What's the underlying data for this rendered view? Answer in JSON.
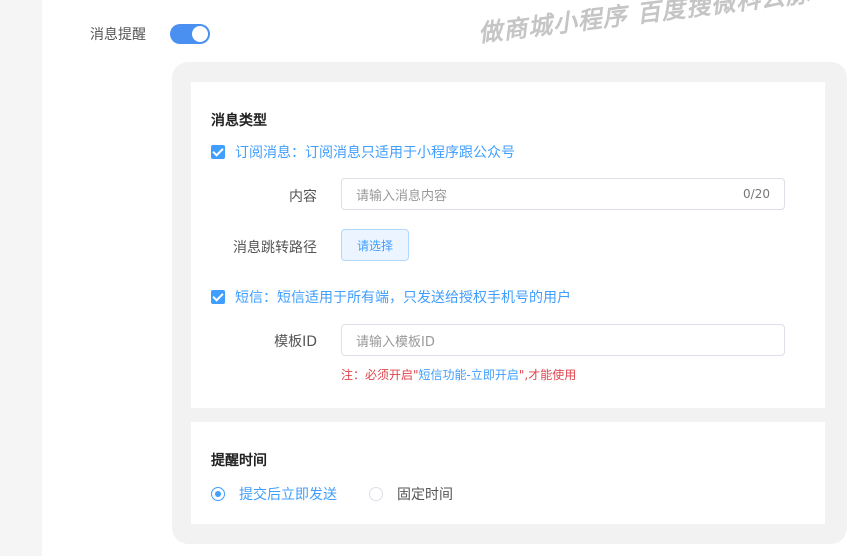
{
  "notify": {
    "label": "消息提醒",
    "enabled": true
  },
  "watermark": "做商城小程序 百度搜微科云脉",
  "message_type": {
    "title": "消息类型",
    "subscribe": {
      "checked": true,
      "label": "订阅消息：订阅消息只适用于小程序跟公众号"
    },
    "content": {
      "label": "内容",
      "placeholder": "请输入消息内容",
      "counter": "0/20"
    },
    "path": {
      "label": "消息跳转路径",
      "button": "请选择"
    },
    "sms": {
      "checked": true,
      "label": "短信：短信适用于所有端，只发送给授权手机号的用户"
    },
    "template": {
      "label": "模板ID",
      "placeholder": "请输入模板ID"
    },
    "note": {
      "prefix": "注：必须开启\"",
      "link": "短信功能-立即开启",
      "suffix": "\",才能使用"
    }
  },
  "remind_time": {
    "title": "提醒时间",
    "options": [
      {
        "label": "提交后立即发送",
        "checked": true
      },
      {
        "label": "固定时间",
        "checked": false
      }
    ]
  },
  "colors": {
    "primary": "#409eff",
    "danger": "#e0454f",
    "switch": "#4a90f0"
  }
}
